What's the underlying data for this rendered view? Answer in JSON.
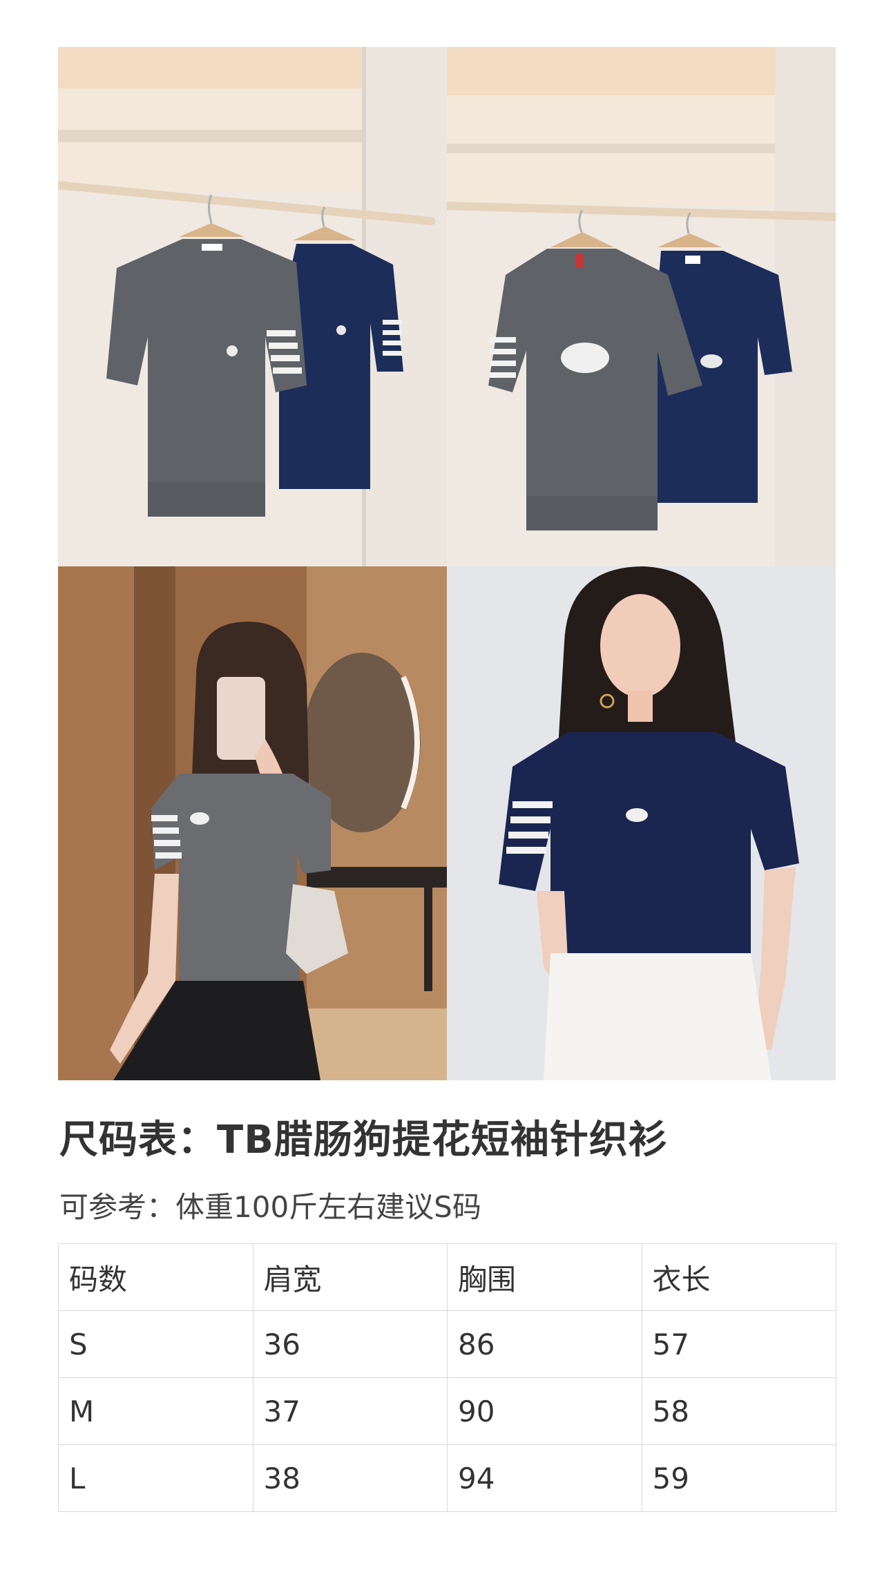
{
  "photos": [
    {
      "name": "photo-hanging-front"
    },
    {
      "name": "photo-hanging-back"
    },
    {
      "name": "photo-mirror-selfie-grey"
    },
    {
      "name": "photo-model-navy"
    }
  ],
  "colors": {
    "grey_knit": "#5f6266",
    "navy_knit": "#1c2d5a",
    "stripe_white": "#f2f2f2"
  },
  "title": "尺码表：TB腊肠狗提花短袖针织衫",
  "subtitle": "可参考：体重100斤左右建议S码",
  "table": {
    "headers": [
      "码数",
      "肩宽",
      "胸围",
      "衣长"
    ],
    "rows": [
      [
        "S",
        "36",
        "86",
        "57"
      ],
      [
        "M",
        "37",
        "90",
        "58"
      ],
      [
        "L",
        "38",
        "94",
        "59"
      ]
    ]
  }
}
